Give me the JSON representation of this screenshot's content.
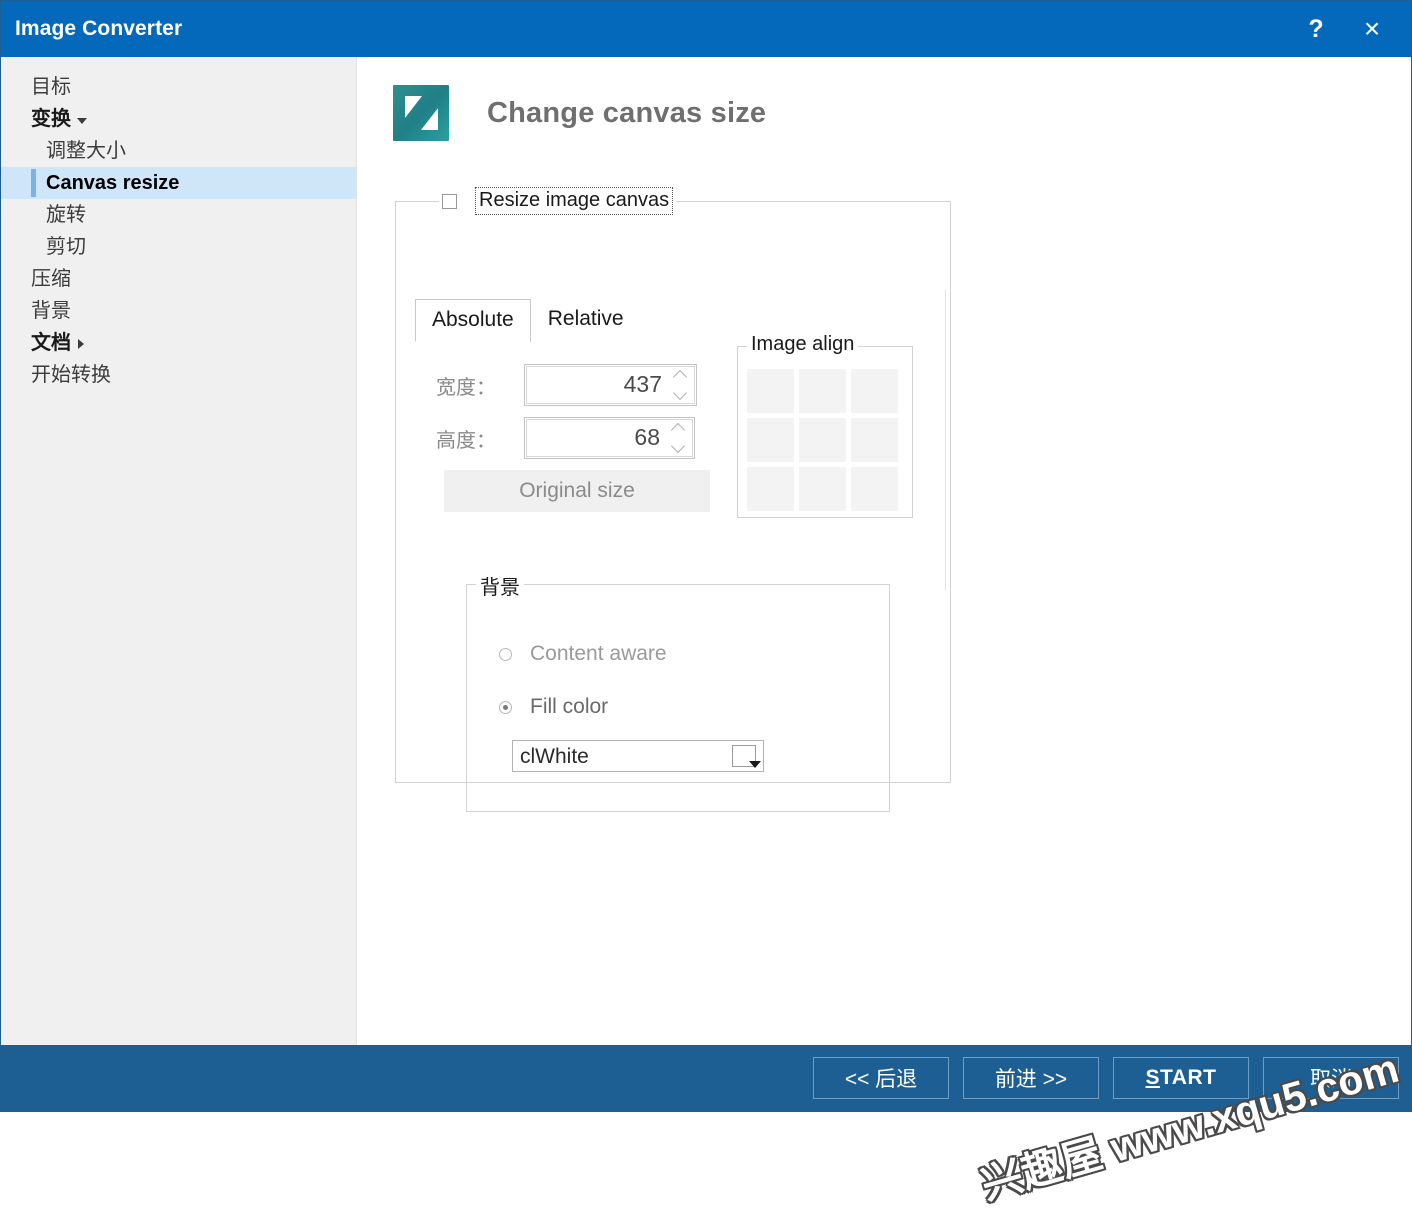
{
  "window": {
    "title": "Image Converter",
    "help_label": "?",
    "close_label": "×"
  },
  "sidebar": {
    "items": [
      {
        "label": "目标",
        "level": 0,
        "bold": false,
        "selected": false,
        "caret": ""
      },
      {
        "label": "变换",
        "level": 0,
        "bold": true,
        "selected": false,
        "caret": "down"
      },
      {
        "label": "调整大小",
        "level": 1,
        "bold": false,
        "selected": false,
        "caret": ""
      },
      {
        "label": "Canvas resize",
        "level": 1,
        "bold": true,
        "selected": true,
        "caret": ""
      },
      {
        "label": "旋转",
        "level": 1,
        "bold": false,
        "selected": false,
        "caret": ""
      },
      {
        "label": "剪切",
        "level": 1,
        "bold": false,
        "selected": false,
        "caret": ""
      },
      {
        "label": "压缩",
        "level": 0,
        "bold": false,
        "selected": false,
        "caret": ""
      },
      {
        "label": "背景",
        "level": 0,
        "bold": false,
        "selected": false,
        "caret": ""
      },
      {
        "label": "文档",
        "level": 0,
        "bold": true,
        "selected": false,
        "caret": "right"
      },
      {
        "label": "开始转换",
        "level": 0,
        "bold": false,
        "selected": false,
        "caret": ""
      }
    ]
  },
  "main": {
    "page_title": "Change canvas size",
    "icon_name": "canvas-resize-icon",
    "resize_group": {
      "checkbox_label": "Resize image canvas",
      "checkbox_checked": false,
      "tabs": [
        {
          "label": "Absolute",
          "active": true
        },
        {
          "label": "Relative",
          "active": false
        }
      ],
      "width_label": "宽度：",
      "width_value": "437",
      "height_label": "高度：",
      "height_value": "68",
      "original_size_label": "Original size",
      "original_size_enabled": false
    },
    "image_align": {
      "legend": "Image align",
      "cells": [
        "top-left",
        "top-center",
        "top-right",
        "middle-left",
        "middle-center",
        "middle-right",
        "bottom-left",
        "bottom-center",
        "bottom-right"
      ]
    },
    "background": {
      "legend": "背景",
      "options": [
        {
          "label": "Content aware",
          "selected": false,
          "enabled": false
        },
        {
          "label": "Fill color",
          "selected": true,
          "enabled": true
        }
      ],
      "fill_color_value": "clWhite",
      "fill_color_hex": "#ffffff"
    }
  },
  "footer": {
    "buttons": [
      {
        "label": "<< 后退",
        "name": "back-button",
        "style": "normal"
      },
      {
        "label": "前进 >>",
        "name": "next-button",
        "style": "normal"
      },
      {
        "label": "START",
        "name": "start-button",
        "style": "start",
        "accesskey": "S"
      },
      {
        "label": "取消",
        "name": "cancel-button",
        "style": "normal"
      }
    ]
  },
  "watermark": {
    "text": "兴趣屋 www.xqu5.com"
  },
  "colors": {
    "titlebar": "#0469ba",
    "footer": "#1d5f93",
    "sidebar": "#f0f0f0",
    "selection": "#cfe5f8",
    "selection_accent": "#7cb3e2",
    "icon_teal": "#2a8f90"
  }
}
